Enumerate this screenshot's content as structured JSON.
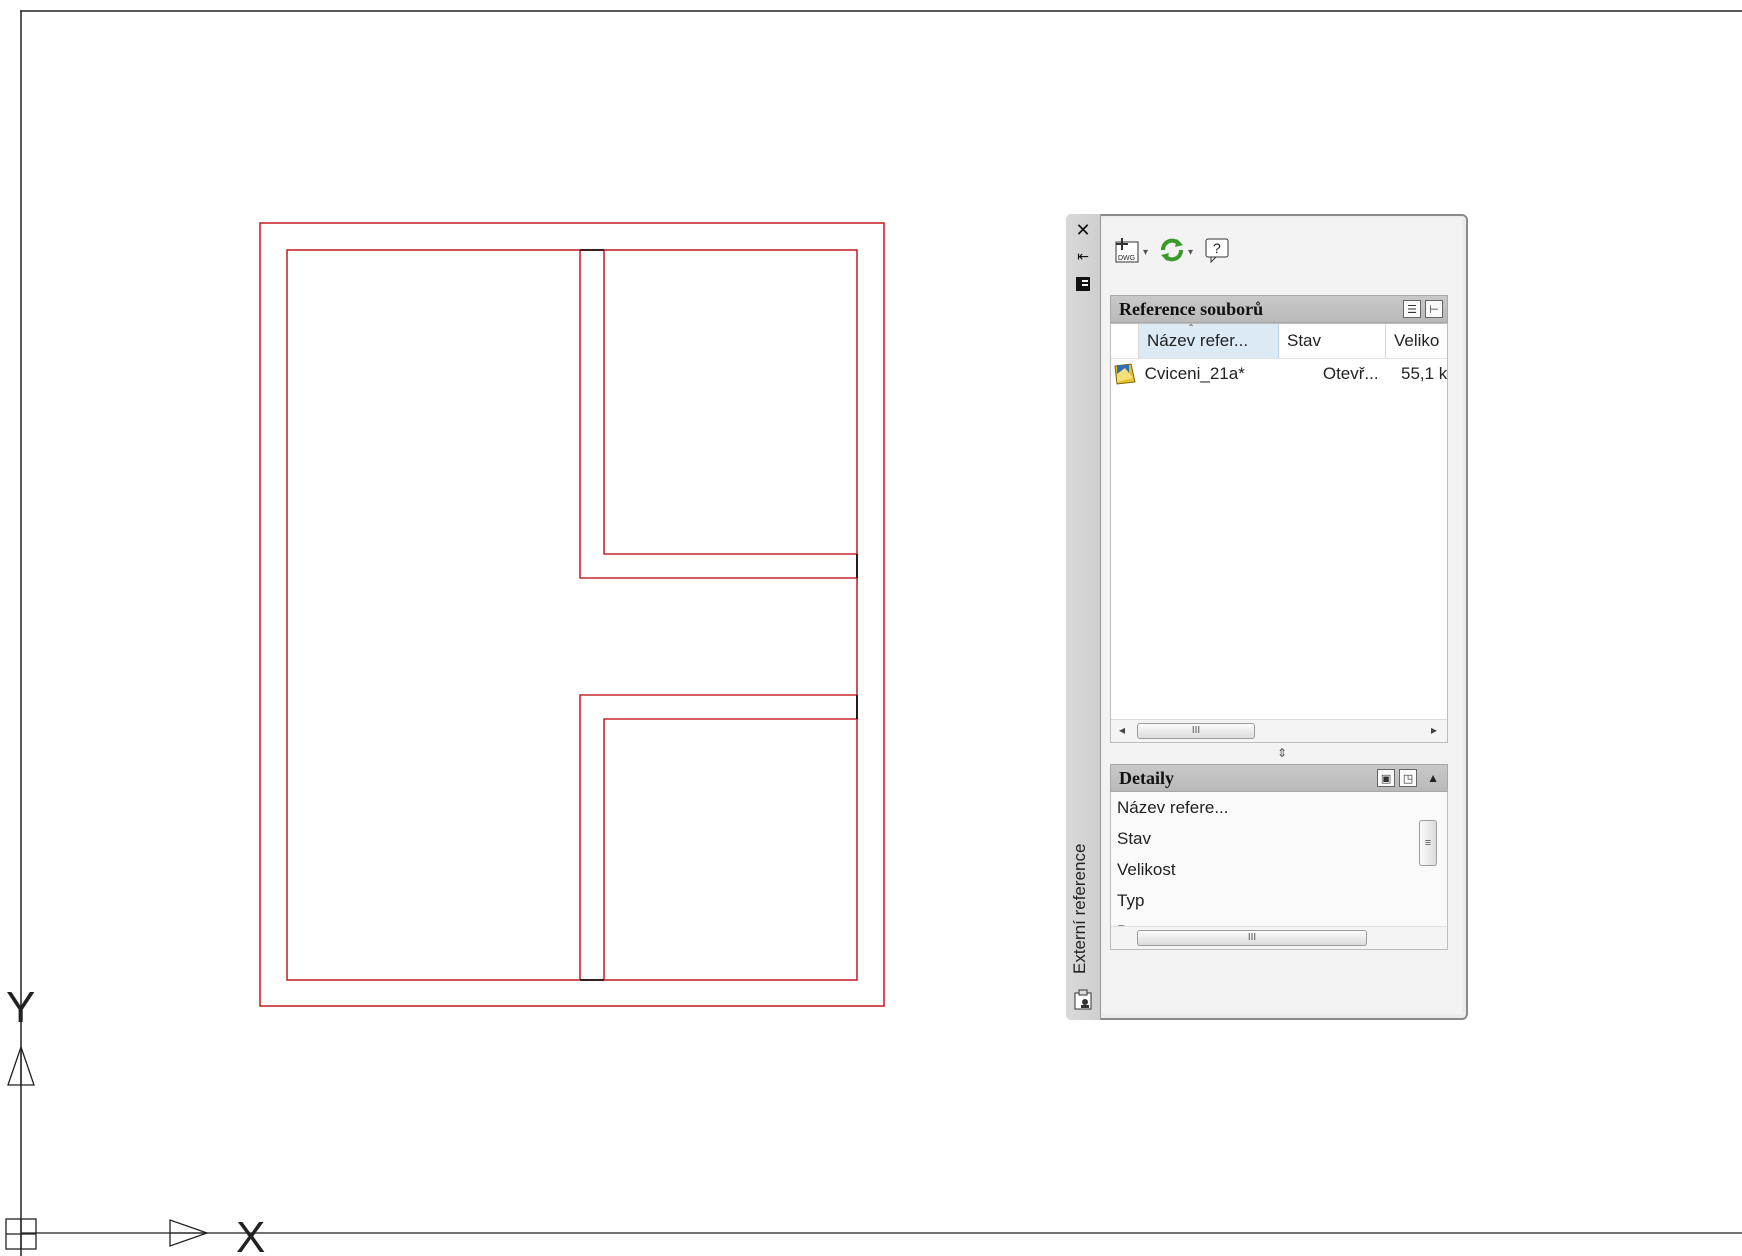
{
  "palette": {
    "title": "Externí reference",
    "close_icon": "close-icon",
    "autohide_icon": "autohide-icon",
    "properties_icon": "properties-icon",
    "toolbar": {
      "attach_dwg_icon": "attach-dwg-icon",
      "dwg_label": "DWG",
      "refresh_icon": "refresh-icon",
      "help_icon": "help-icon"
    },
    "file_references": {
      "header": "Reference souborů",
      "list_view_icon": "list-view-icon",
      "tree_view_icon": "tree-view-icon",
      "columns": [
        "Název refer...",
        "Stav",
        "Veliko"
      ],
      "rows": [
        {
          "name": "Cviceni_21a*",
          "status": "Otevř...",
          "size": "55,1 k",
          "icon": "drawing-file-icon"
        }
      ],
      "scroll_thumb_label": "III"
    },
    "details": {
      "header": "Detaily",
      "labels": [
        "Název refere...",
        "Stav",
        "Velikost",
        "Typ",
        "Datum"
      ],
      "scroll_thumb_label": "III",
      "vscroll_thumb_label": "≡"
    }
  },
  "drawing": {
    "ucs_labels": {
      "y": "Y",
      "x": "X"
    },
    "colors": {
      "red_line": "#c8272d",
      "black_line": "#000000",
      "background": "#ffffff"
    }
  }
}
